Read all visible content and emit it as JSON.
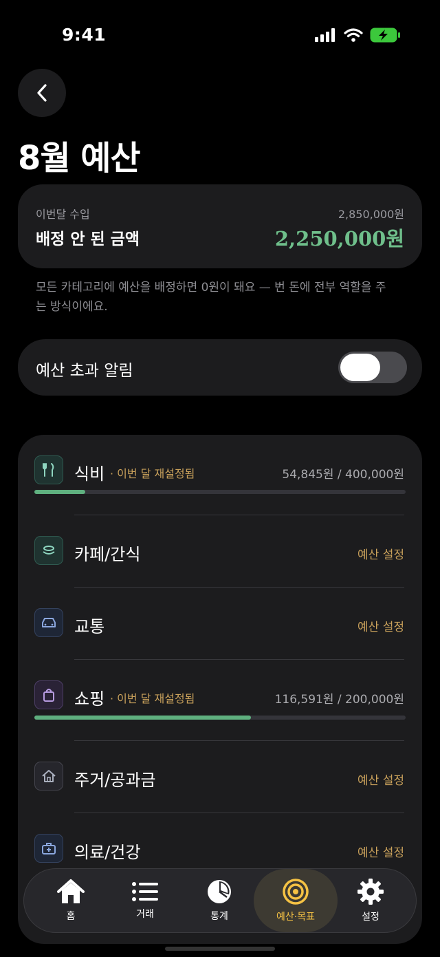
{
  "status_bar": {
    "time": "9:41"
  },
  "header": {
    "title": "8월 예산"
  },
  "income": {
    "label": "이번달 수입",
    "value": "2,850,000원",
    "unassigned_label": "배정 안 된 금액",
    "unassigned_value": "2,250,000원",
    "accent_color": "#6fbf8b"
  },
  "description": "모든 카테고리에 예산을 배정하면 0원이 돼요 — 번 돈에 전부 역할을 주는 방식이에요.",
  "alert": {
    "label": "예산 초과 알림",
    "enabled": false
  },
  "categories": [
    {
      "name": "식비",
      "icon": "fork-knife-icon",
      "note": "· 이번 달 재설정됨",
      "amount": "54,845원 / 400,000원",
      "progress": 0.137
    },
    {
      "name": "카페/간식",
      "icon": "cup-icon",
      "action": "예산 설정"
    },
    {
      "name": "교통",
      "icon": "car-icon",
      "action": "예산 설정"
    },
    {
      "name": "쇼핑",
      "icon": "shopping-bag-icon",
      "note": "· 이번 달 재설정됨",
      "amount": "116,591원 / 200,000원",
      "progress": 0.583
    },
    {
      "name": "주거/공과금",
      "icon": "house-icon",
      "action": "예산 설정"
    },
    {
      "name": "의료/건강",
      "icon": "medical-kit-icon",
      "action": "예산 설정"
    }
  ],
  "tabs": [
    {
      "label": "홈",
      "icon": "home-icon"
    },
    {
      "label": "거래",
      "icon": "list-icon"
    },
    {
      "label": "통계",
      "icon": "pie-chart-icon"
    },
    {
      "label": "예산·목표",
      "icon": "target-icon",
      "active": true
    },
    {
      "label": "설정",
      "icon": "gear-icon"
    }
  ],
  "colors": {
    "gold": "#c9a15b",
    "tab_active": "#f5c244",
    "progress": "#5fb07f"
  }
}
